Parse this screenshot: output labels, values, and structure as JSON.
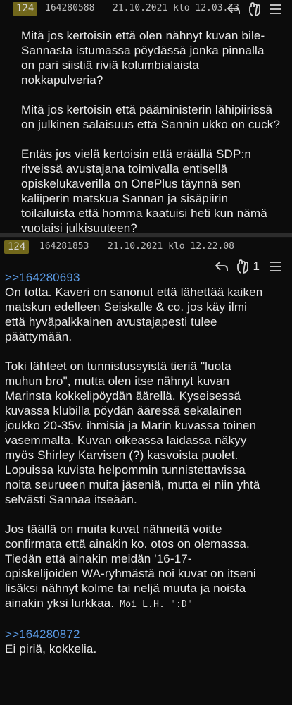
{
  "posts": [
    {
      "reply_count_badge": "124",
      "post_number": "164280588",
      "date": "21.10.2021 klo 12.03.13",
      "body": [
        [
          "Mitä jos kertoisin että olen nähnyt kuvan bile-",
          "Sannasta istumassa pöydässä jonka pinnalla",
          "on pari siistiä riviä kolumbialaista",
          "nokkapulveria?"
        ],
        [
          "Mitä jos kertoisin että pääministerin lähipiirissä",
          "on julkinen salaisuus että Sannin ukko on cuck?"
        ],
        [
          "Entäs jos vielä kertoisin että eräällä SDP:n",
          "riveissä avustajana toimivalla entisellä",
          "opiskelukaverilla on OnePlus täynnä sen",
          "kaliiperin matskua Sannan ja sisäpiirin",
          "toilailuista että homma kaatuisi heti kun nämä",
          "vuotaisi julkisuuteen?"
        ]
      ]
    },
    {
      "reply_count_badge": "124",
      "post_number": "164281853",
      "date": "21.10.2021 klo 12.22.08",
      "like_count": "1",
      "quote1": ">>164280693",
      "body1": [
        [
          "On totta. Kaveri on sanonut että lähettää kaiken",
          "matskun edelleen Seiskalle & co. jos käy ilmi",
          "että hyväpalkkainen avustajapesti tulee",
          "päättymään."
        ],
        [
          "Toki lähteet on tunnistussyistä tieriä \"luota",
          "muhun bro\", mutta olen itse nähnyt kuvan",
          "Marinsta kokkelipöydän äärellä. Kyseisessä",
          "kuvassa klubilla pöydän ääressä sekalainen",
          "joukko 20-35v. ihmisiä ja Marin kuvassa toinen",
          "vasemmalta. Kuvan oikeassa laidassa näkyy",
          "myös Shirley Karvisen (?) kasvoista puolet.",
          "Lopuissa kuvista helpommin tunnistettavissa",
          "noita seurueen muita jäseniä, mutta ei niin yhtä",
          "selvästi Sannaa itseään."
        ],
        [
          "Jos täällä on muita kuvat nähneitä voitte",
          "confirmata että ainakin ko. otos on olemassa.",
          "Tiedän että ainakin meidän '16-17-",
          "opiskelijoiden WA-ryhmästä noi kuvat on itseni",
          "lisäksi nähnyt kolme tai neljä muuta ja noista"
        ]
      ],
      "last_line_text": "ainakin yksi lurkkaa.",
      "last_line_small": " Moi L.H. \":D\"",
      "quote2": ">>164280872",
      "body2": "Ei piriä, kokkelia."
    }
  ],
  "icons": [
    "reply-icon",
    "like-hand-icon",
    "menu-icon"
  ]
}
